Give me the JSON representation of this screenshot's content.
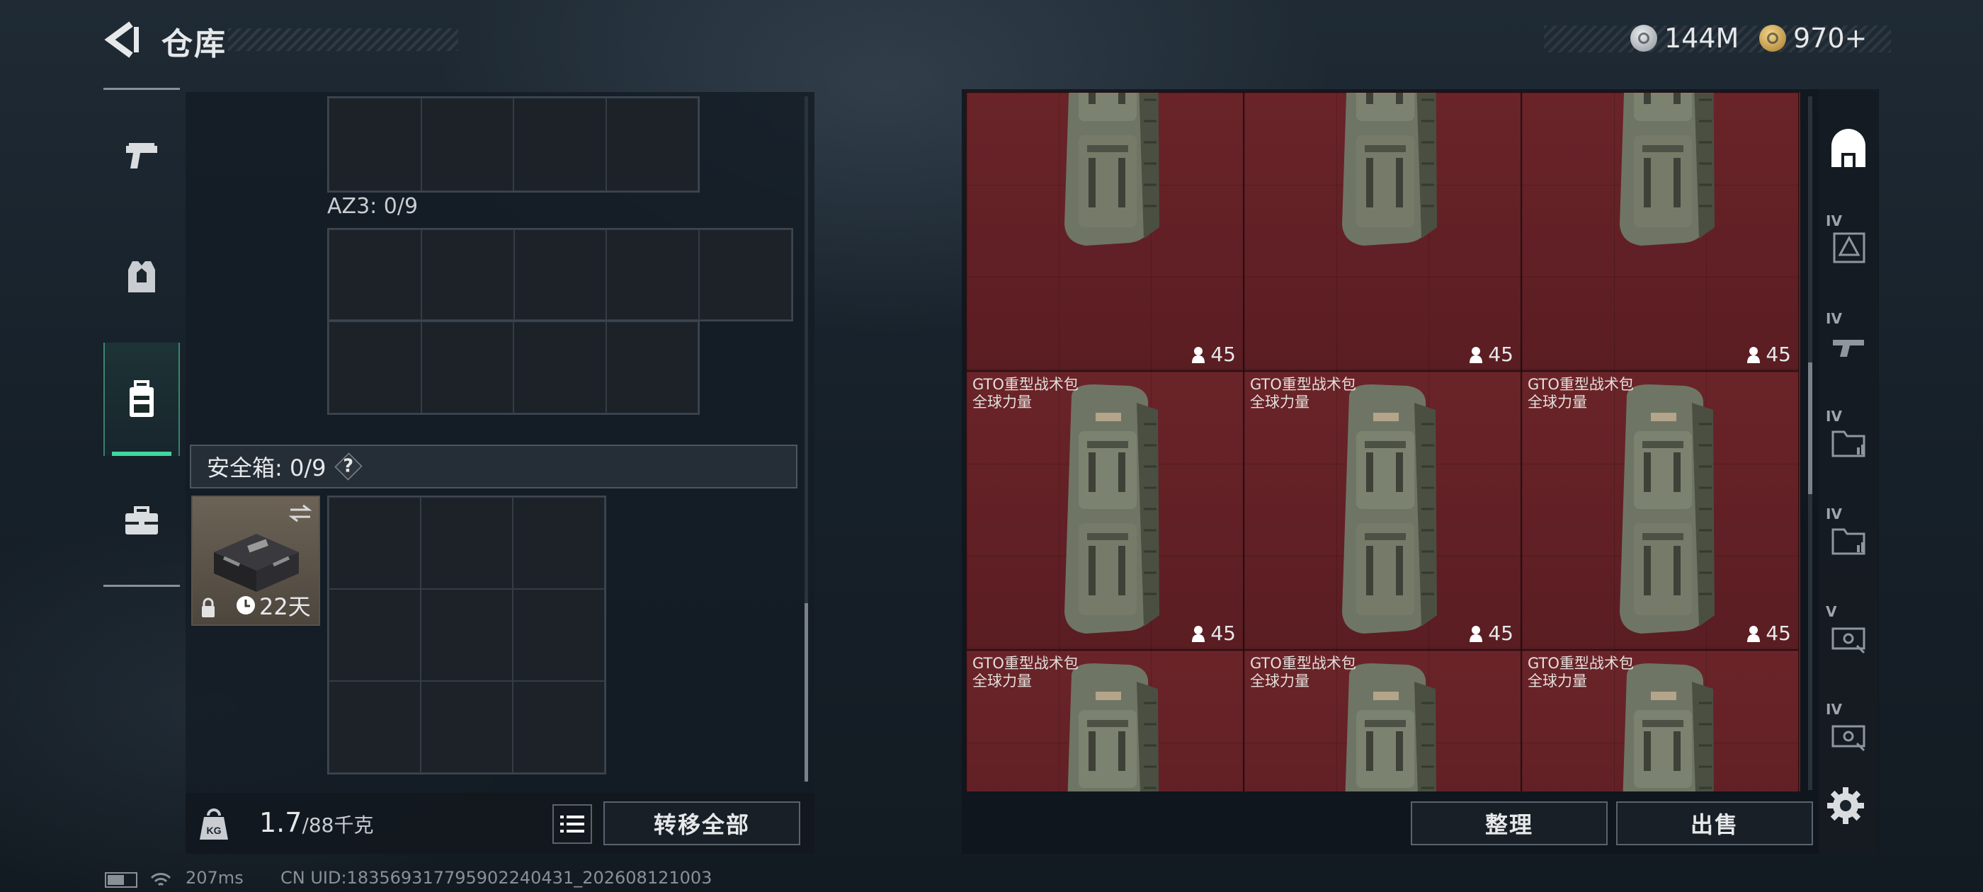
{
  "header": {
    "title": "仓库",
    "currencies": [
      {
        "icon": "silver-coin-icon",
        "value": "144M"
      },
      {
        "icon": "gold-coin-icon",
        "value": "970+"
      }
    ]
  },
  "left_rail": {
    "items": [
      {
        "name": "weapons",
        "icon": "pistol-icon",
        "active": false
      },
      {
        "name": "armor",
        "icon": "armor-vest-icon",
        "active": false
      },
      {
        "name": "backpack",
        "icon": "backpack-icon",
        "active": true
      },
      {
        "name": "cases",
        "icon": "briefcase-icon",
        "active": false
      }
    ]
  },
  "loadout": {
    "az_label": "AZ3: 0/9",
    "safebox": {
      "label": "安全箱: 0/9",
      "help": "?",
      "duration": "22天"
    },
    "weight": {
      "current": "1.7",
      "max": "/88千克"
    },
    "transfer_all": "转移全部"
  },
  "stash": {
    "items": [
      {
        "name": "",
        "sub": "",
        "count": "45",
        "partial": true
      },
      {
        "name": "",
        "sub": "",
        "count": "45",
        "partial": true
      },
      {
        "name": "",
        "sub": "",
        "count": "45",
        "partial": true
      },
      {
        "name": "GTO重型战术包",
        "sub": "全球力量",
        "count": "45"
      },
      {
        "name": "GTO重型战术包",
        "sub": "全球力量",
        "count": "45"
      },
      {
        "name": "GTO重型战术包",
        "sub": "全球力量",
        "count": "45"
      },
      {
        "name": "GTO重型战术包",
        "sub": "全球力量",
        "count": ""
      },
      {
        "name": "GTO重型战术包",
        "sub": "全球力量",
        "count": ""
      },
      {
        "name": "GTO重型战术包",
        "sub": "全球力量",
        "count": ""
      }
    ],
    "sort_button": "整理",
    "sell_button": "出售"
  },
  "filter_rail": {
    "items": [
      {
        "icon": "stash-all-icon",
        "tier": ""
      },
      {
        "icon": "tier4-helmet-icon",
        "tier": "IV"
      },
      {
        "icon": "tier4-weapon-icon",
        "tier": "IV"
      },
      {
        "icon": "tier4-folder-icon",
        "tier": "IV"
      },
      {
        "icon": "tier4-folder-icon",
        "tier": "IV"
      },
      {
        "icon": "tier5-device-icon",
        "tier": "V"
      },
      {
        "icon": "tier4-device-icon",
        "tier": "IV"
      }
    ]
  },
  "status": {
    "ping": "207ms",
    "uid": "CN UID:18356931779590224043​1_202608121003"
  },
  "colors": {
    "accent": "#3ed7a0",
    "stash_bg": "#5e1f23"
  }
}
